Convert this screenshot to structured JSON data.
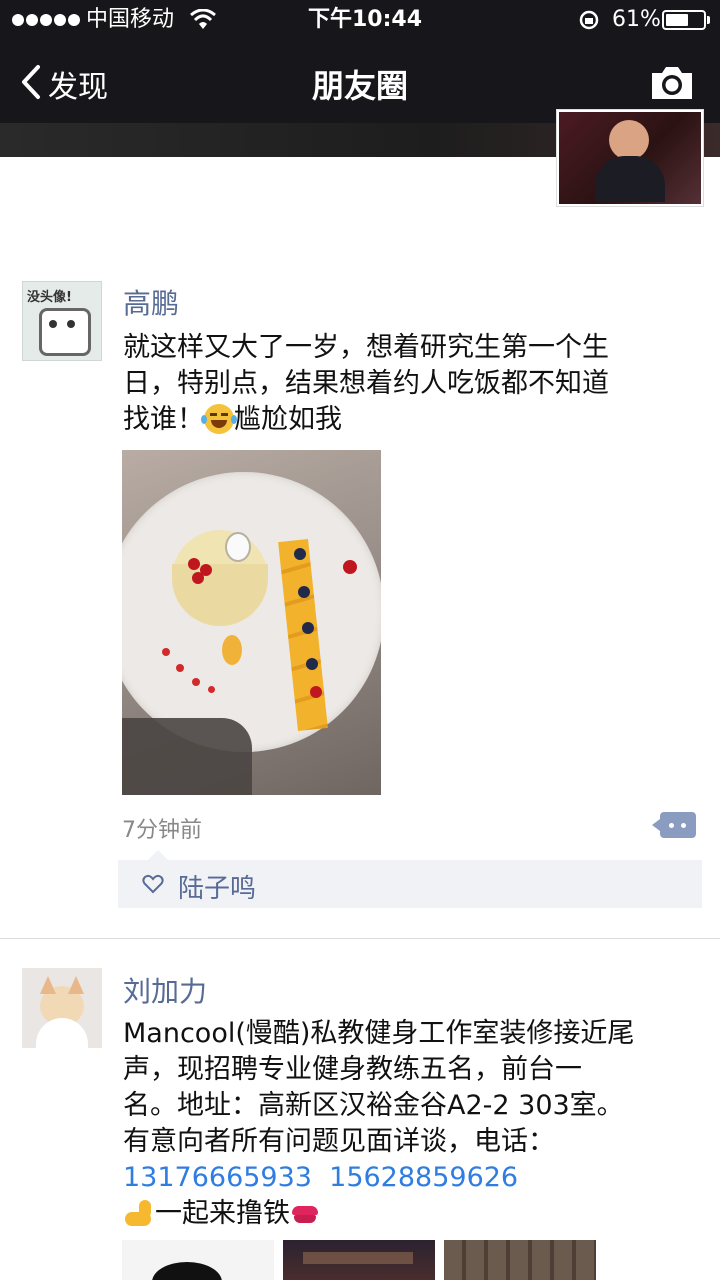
{
  "status_bar": {
    "carrier": "中国移动",
    "time": "下午10:44",
    "battery_pct": "61%",
    "battery_level": 0.61
  },
  "nav": {
    "back_label": "发现",
    "title": "朋友圈",
    "camera_icon": "camera-icon"
  },
  "posts": [
    {
      "user": "高鹏",
      "avatar_text": "没头像!",
      "lines": [
        "就这样又大了一岁，想着研究生第一个生",
        "日，特别点，结果想着约人吃饭都不知道",
        "找谁！"
      ],
      "suffix": "尴尬如我",
      "time": "7分钟前",
      "likes": "陆子鸣"
    },
    {
      "user": "刘加力",
      "lines": [
        "Mancool(慢酷)私教健身工作室装修接近尾",
        "声，现招聘专业健身教练五名，前台一",
        "名。地址：高新区汉裕金谷A2-2 303室。",
        "有意向者所有问题见面详谈，电话："
      ],
      "phone1": "13176665933",
      "phone2": "15628859626",
      "tail": "一起来撸铁"
    }
  ]
}
